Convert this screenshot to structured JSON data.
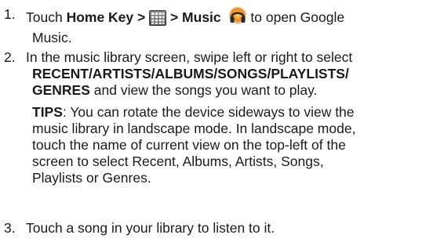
{
  "steps": [
    {
      "number": "1.",
      "line1_prefix": "Touch ",
      "line1_bold_a": "Home Key >",
      "line1_bold_b": " > Music",
      "line1_suffix": " to open Google",
      "line2": "Music."
    },
    {
      "number": "2.",
      "line1": "In the music library screen, swipe left or right to select",
      "line2_bold": "RECENT/ARTISTS/ALBUMS/SONGS/PLAYLISTS/",
      "line3_bold": "GENRES",
      "line3_rest": " and view the songs you want to play.",
      "tips": {
        "label": "TIPS",
        "line1_rest": ": You can rotate the device sideways to view the",
        "line2": "music library in landscape mode. In landscape mode,",
        "line3": "touch the name of current view on the top-left of the",
        "line4": "screen to select Recent, Albums, Artists, Songs,",
        "line5": "Playlists or Genres."
      }
    },
    {
      "number": "3.",
      "line1": "Touch a song in your library to listen to it."
    }
  ],
  "icons": {
    "apps_grid": "apps-grid-icon",
    "music": "headphones-icon"
  }
}
